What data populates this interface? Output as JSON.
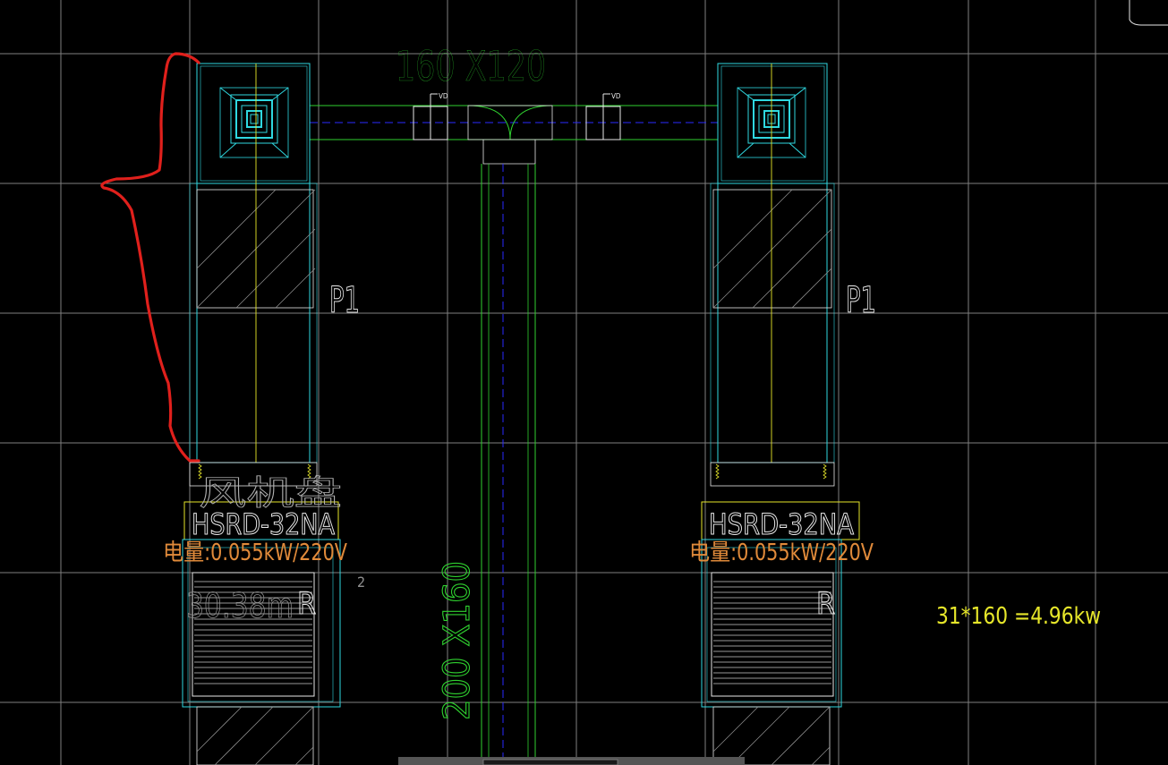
{
  "drawing": {
    "duct_top_label": "160 X120",
    "duct_vertical_label": "200 X160",
    "valve_tag": "VD",
    "unit_tag": "P1",
    "model_label": "HSRD-32NA",
    "power_label": "电量:0.055kW/220V",
    "grille_tag": "R",
    "area_label": "30.38m",
    "area_superscript": "2",
    "calc_note": "31*160 =4.96kw",
    "overlap_text": "风机盘"
  },
  "colors": {
    "background": "#000000",
    "grid": "#7f7f7f",
    "cyan": "#2fd8e0",
    "green": "#2fd02f",
    "yellow": "#e6e62a",
    "orange": "#e08a3a",
    "blue": "#2a2aff",
    "white": "#e8e8e8",
    "red": "#e0201c",
    "hatch": "#8a8a8a"
  }
}
